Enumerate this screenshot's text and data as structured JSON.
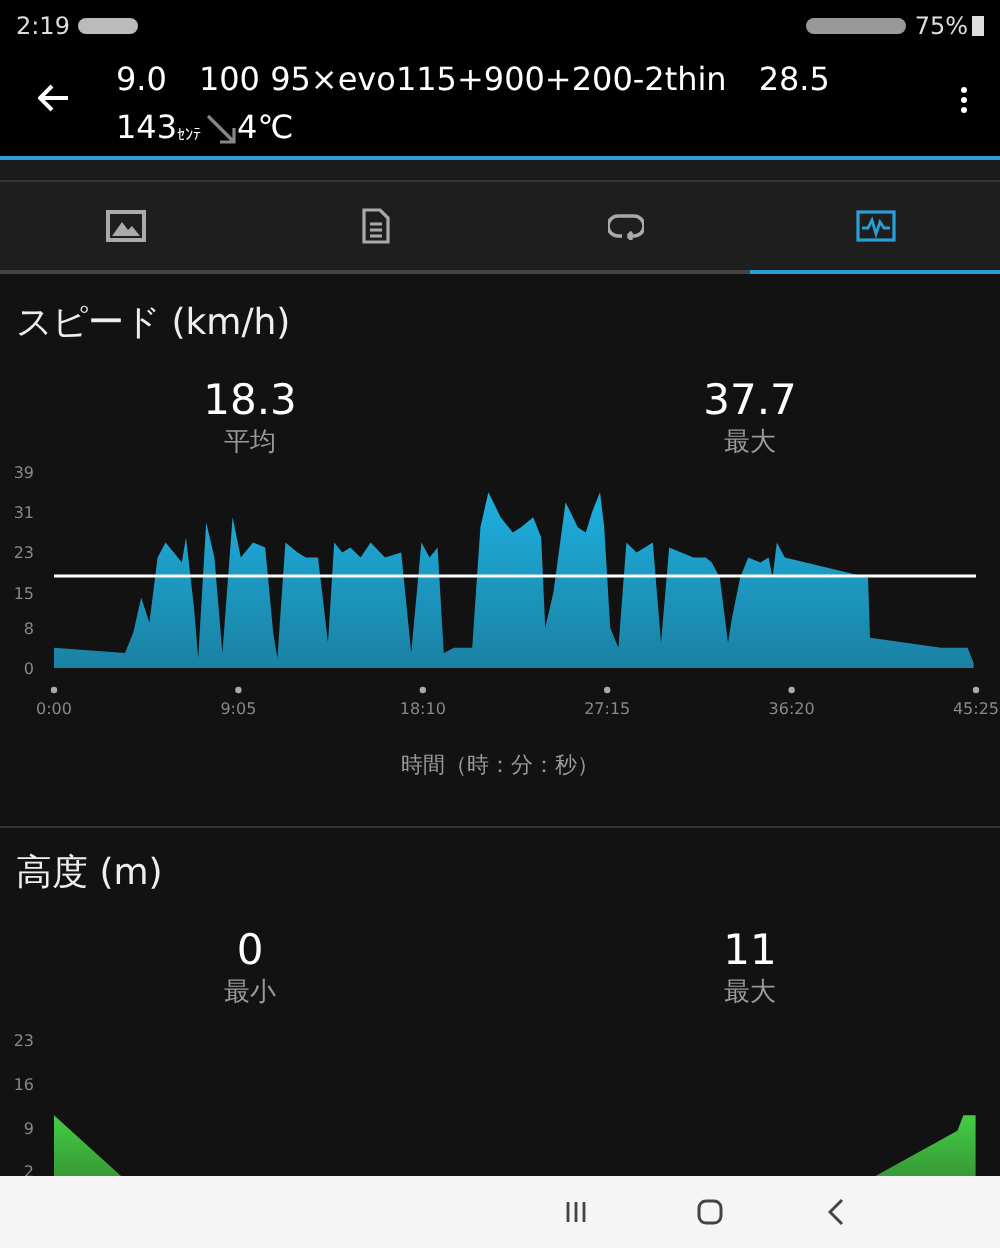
{
  "status_bar": {
    "time": "2:19",
    "battery": "75%"
  },
  "header": {
    "title": "9.0　100 95×evo115+900+200-2thin　28.5",
    "distance": "143",
    "distance_unit": "ｾﾝﾃ",
    "temperature": "4℃"
  },
  "tabs": [
    {
      "kind": "map",
      "selected": false
    },
    {
      "kind": "details",
      "selected": false
    },
    {
      "kind": "laps",
      "selected": false
    },
    {
      "kind": "charts",
      "selected": true
    }
  ],
  "sections": [
    {
      "title": "スピード (km/h)",
      "stats": [
        {
          "value": "18.3",
          "label": "平均"
        },
        {
          "value": "37.7",
          "label": "最大"
        }
      ],
      "chart_data": {
        "type": "area",
        "xlabel": "時間（時：分：秒）",
        "xlim": [
          0,
          45.4167
        ],
        "ylim": [
          0,
          39
        ],
        "x": [
          0,
          3.5,
          3.9,
          4.3,
          4.7,
          5.1,
          5.5,
          5.9,
          6.3,
          6.5,
          6.9,
          7.1,
          7.5,
          7.9,
          8.3,
          8.8,
          9.2,
          9.8,
          10.4,
          10.8,
          11.0,
          11.4,
          12.0,
          12.4,
          13.0,
          13.5,
          13.8,
          14.2,
          14.6,
          15.1,
          15.6,
          16.3,
          17.1,
          17.6,
          18.1,
          18.5,
          18.9,
          19.2,
          19.7,
          20.6,
          21.0,
          21.4,
          22.0,
          22.6,
          23.0,
          23.6,
          24.0,
          24.2,
          24.6,
          25.2,
          25.8,
          26.2,
          26.5,
          26.9,
          27.1,
          27.4,
          27.8,
          28.2,
          28.7,
          29.5,
          29.9,
          30.3,
          30.9,
          31.5,
          32.1,
          32.4,
          32.8,
          33.2,
          33.4,
          33.8,
          34.2,
          34.8,
          35.2,
          35.4,
          35.6,
          36.0,
          40.1,
          40.2,
          43.7,
          45.0,
          45.3
        ],
        "series": [
          {
            "color": "#1eb0e0",
            "values": [
              4,
              3,
              7,
              14,
              9,
              22,
              25,
              23,
              21,
              26,
              12,
              2,
              29,
              22,
              3,
              30,
              22,
              25,
              24,
              7,
              2,
              25,
              23,
              22,
              22,
              5,
              25,
              23,
              24,
              22,
              25,
              22,
              23,
              3,
              25,
              22,
              24,
              3,
              4,
              4,
              28,
              35,
              30,
              27,
              28,
              30,
              26,
              8,
              15,
              33,
              28,
              27,
              31,
              35,
              28,
              8,
              4,
              25,
              23,
              25,
              5,
              24,
              23,
              22,
              22,
              21,
              18,
              5,
              10,
              18,
              22,
              21,
              22,
              18,
              25,
              22,
              18,
              6,
              4,
              4,
              1
            ]
          }
        ],
        "xticks": [
          {
            "value": 0,
            "label": "0:00"
          },
          {
            "value": 9.0833,
            "label": "9:05"
          },
          {
            "value": 18.1667,
            "label": "18:10"
          },
          {
            "value": 27.25,
            "label": "27:15"
          },
          {
            "value": 36.3333,
            "label": "36:20"
          },
          {
            "value": 45.4167,
            "label": "45:25"
          }
        ],
        "yticks": [
          0,
          8,
          15,
          23,
          31,
          39
        ],
        "ref_lines": [
          {
            "axis": "y",
            "value": 18.3
          }
        ]
      }
    },
    {
      "title": "高度 (m)",
      "stats": [
        {
          "value": "0",
          "label": "最小"
        },
        {
          "value": "11",
          "label": "最大"
        }
      ],
      "chart_data": {
        "type": "area",
        "xlim": [
          0,
          45.4167
        ],
        "ylim": [
          0,
          23
        ],
        "x": [
          0,
          3.4,
          20,
          40.3,
          44.5,
          44.8,
          45.4
        ],
        "series": [
          {
            "color": "#44cc44",
            "values": [
              11,
              1,
              null,
              1,
              8.5,
              11,
              11
            ]
          }
        ],
        "yticks": [
          2,
          9,
          16,
          23
        ]
      }
    }
  ]
}
